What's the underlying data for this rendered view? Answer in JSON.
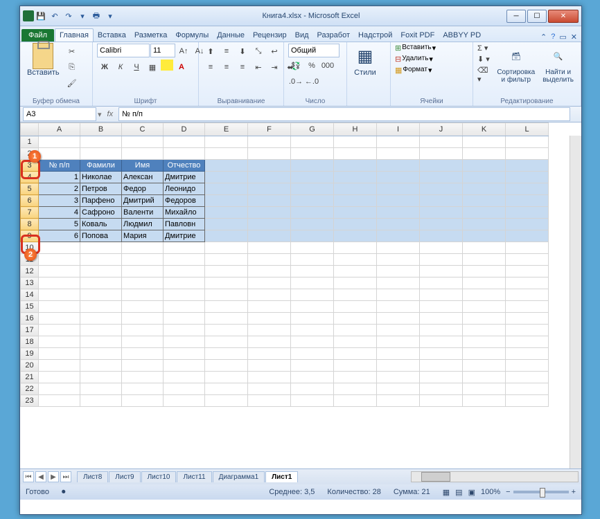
{
  "title": "Книга4.xlsx  -  Microsoft Excel",
  "tabs": {
    "file": "Файл",
    "home": "Главная",
    "insert": "Вставка",
    "layout": "Разметка",
    "formulas": "Формулы",
    "data": "Данные",
    "review": "Рецензир",
    "view": "Вид",
    "dev": "Разработ",
    "addins": "Надстрой",
    "foxit": "Foxit PDF",
    "abbyy": "ABBYY PD"
  },
  "groups": {
    "clipboard": "Буфер обмена",
    "font": "Шрифт",
    "align": "Выравнивание",
    "number": "Число",
    "styles": "Стили",
    "cells": "Ячейки",
    "editing": "Редактирование"
  },
  "btns": {
    "paste": "Вставить",
    "styles": "Стили",
    "insert": "Вставить",
    "delete": "Удалить",
    "format": "Формат",
    "sort": "Сортировка\nи фильтр",
    "find": "Найти и\nвыделить"
  },
  "font": {
    "name": "Calibri",
    "size": "11"
  },
  "numfmt": "Общий",
  "namebox": "A3",
  "formula": "№ п/п",
  "cols": [
    "A",
    "B",
    "C",
    "D",
    "E",
    "F",
    "G",
    "H",
    "I",
    "J",
    "K",
    "L"
  ],
  "rows": [
    1,
    2,
    3,
    4,
    5,
    6,
    7,
    8,
    9,
    10,
    11,
    12,
    13,
    14,
    15,
    16,
    17,
    18,
    19,
    20,
    21,
    22,
    23
  ],
  "table": {
    "headers": [
      "№ п/п",
      "Фамили",
      "Имя",
      "Отчество"
    ],
    "data": [
      [
        "1",
        "Николае",
        "Алексан",
        "Дмитрие"
      ],
      [
        "2",
        "Петров",
        "Федор",
        "Леонидо"
      ],
      [
        "3",
        "Парфено",
        "Дмитрий",
        "Федоров"
      ],
      [
        "4",
        "Сафроно",
        "Валенти",
        "Михайло"
      ],
      [
        "5",
        "Коваль",
        "Людмил",
        "Павловн"
      ],
      [
        "6",
        "Попова",
        "Мария",
        "Дмитрие"
      ]
    ]
  },
  "sheets": [
    "Лист8",
    "Лист9",
    "Лист10",
    "Лист11",
    "Диаграмма1",
    "Лист1"
  ],
  "status": {
    "ready": "Готово",
    "avg": "Среднее: 3,5",
    "count": "Количество: 28",
    "sum": "Сумма: 21",
    "zoom": "100%"
  },
  "callouts": {
    "1": "1",
    "2": "2"
  }
}
